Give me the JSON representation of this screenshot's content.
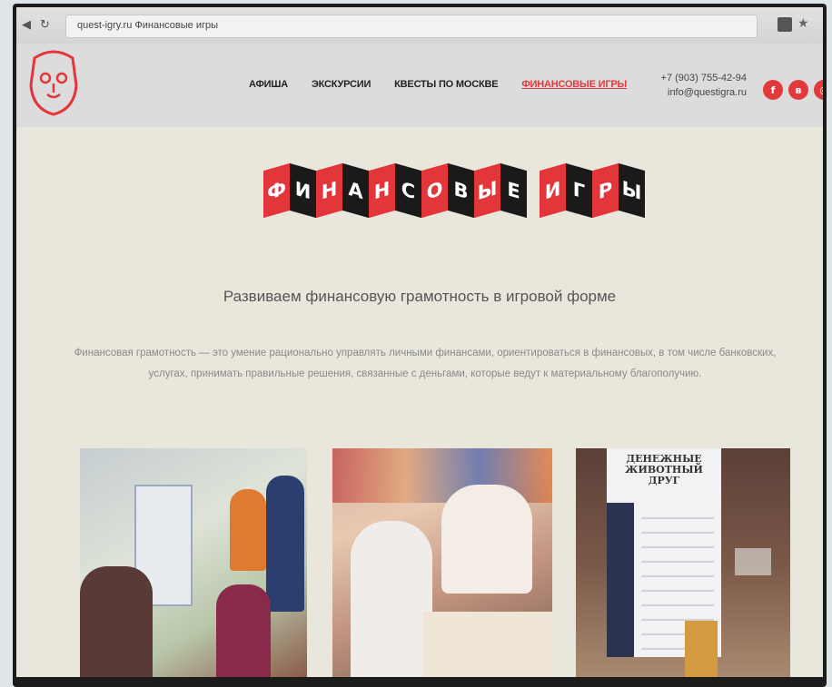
{
  "browser": {
    "back_icon": "back-arrow-icon",
    "url": "quest-igry.ru  Финансовые игры",
    "ext_icon": "extension-icon",
    "bookmark_icon": "star-icon"
  },
  "site": {
    "nav": [
      {
        "label": "АФИША",
        "active": false
      },
      {
        "label": "ЭКСКУРСИИ",
        "active": false
      },
      {
        "label": "КВЕСТЫ ПО МОСКВЕ",
        "active": false
      },
      {
        "label": "ФИНАНСОВЫЕ ИГРЫ",
        "active": true
      }
    ],
    "phone": "+7 (903) 755-42-94",
    "email": "info@questigra.ru",
    "social": [
      {
        "name": "facebook-icon",
        "glyph": "f"
      },
      {
        "name": "vk-icon",
        "glyph": "в"
      },
      {
        "name": "instagram-icon",
        "glyph": "◎"
      }
    ],
    "accent": "#e3363b"
  },
  "banner": {
    "letters": [
      "Ф",
      "И",
      "Н",
      "А",
      "Н",
      "С",
      "О",
      "В",
      "Ы",
      "Е",
      " ",
      "И",
      "Г",
      "Р",
      "Ы"
    ]
  },
  "main": {
    "subtitle": "Развиваем финансовую грамотность в игровой форме",
    "description": "Финансовая грамотность — это умение рационально управлять личными финансами, ориентироваться в финансовых, в том числе банковских, услугах, принимать правильные решения, связанные с деньгами, которые ведут к материальному благополучию."
  },
  "photos": [
    {
      "name": "photo-children-game"
    },
    {
      "name": "photo-students-table"
    },
    {
      "name": "photo-poster-stand",
      "poster_title": "ДЕНЕЖНЫЕ ЖИВОТНЫЙ ДРУГ"
    }
  ]
}
